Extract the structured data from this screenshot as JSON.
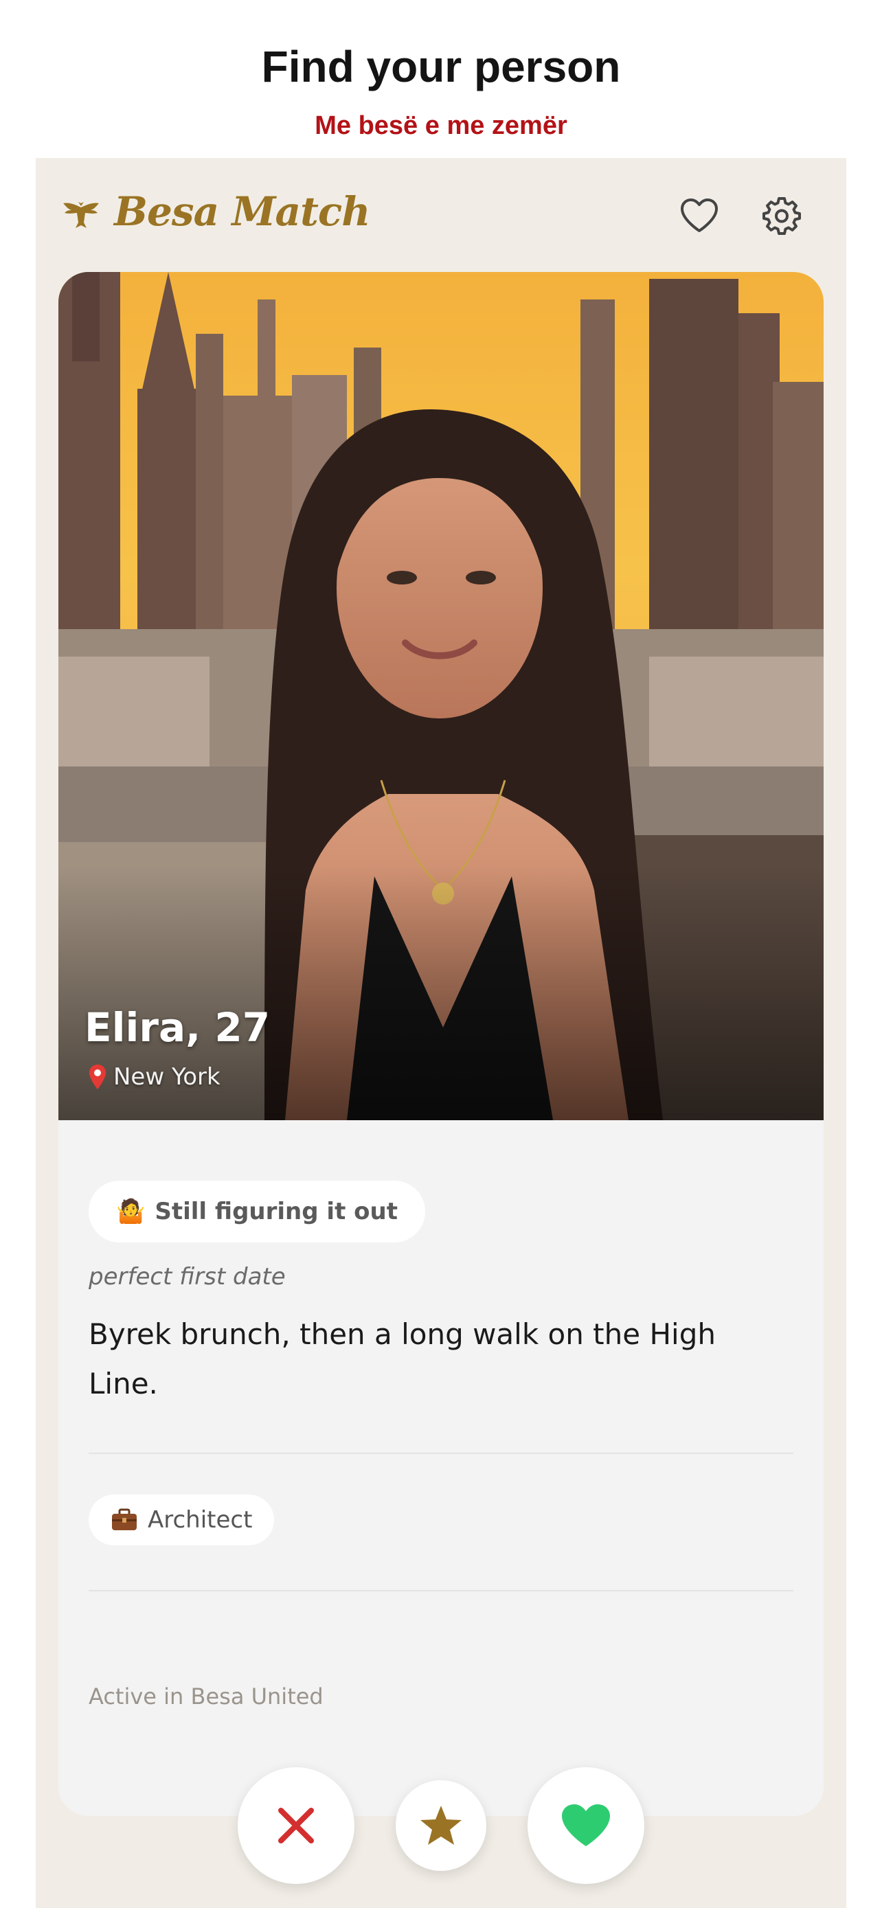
{
  "page": {
    "title": "Find your person",
    "subtitle": "Me besë e me zemër",
    "subtitle_color": "#b31217"
  },
  "app": {
    "brand_name": "Besa Match",
    "brand_color": "#9a7424",
    "brand_icon": "eagle-icon",
    "header_icons": [
      "heart-icon",
      "settings-gear-icon"
    ]
  },
  "profile": {
    "name_age": "Elira, 27",
    "location_icon": "map-pin-icon",
    "location": "New York",
    "status_emoji": "🤷",
    "status": "Still figuring it out",
    "prompt_label": "perfect first date",
    "prompt_answer": "Byrek brunch, then a long walk on the High Line.",
    "job_icon": "briefcase-icon",
    "job": "Architect",
    "activity": "Active in Besa United"
  },
  "actions": {
    "pass_icon": "close-icon",
    "pass_color": "#d32f2f",
    "super_like_icon": "star-icon",
    "super_like_color": "#9a7424",
    "like_icon": "heart-icon",
    "like_color": "#2ecc71"
  }
}
